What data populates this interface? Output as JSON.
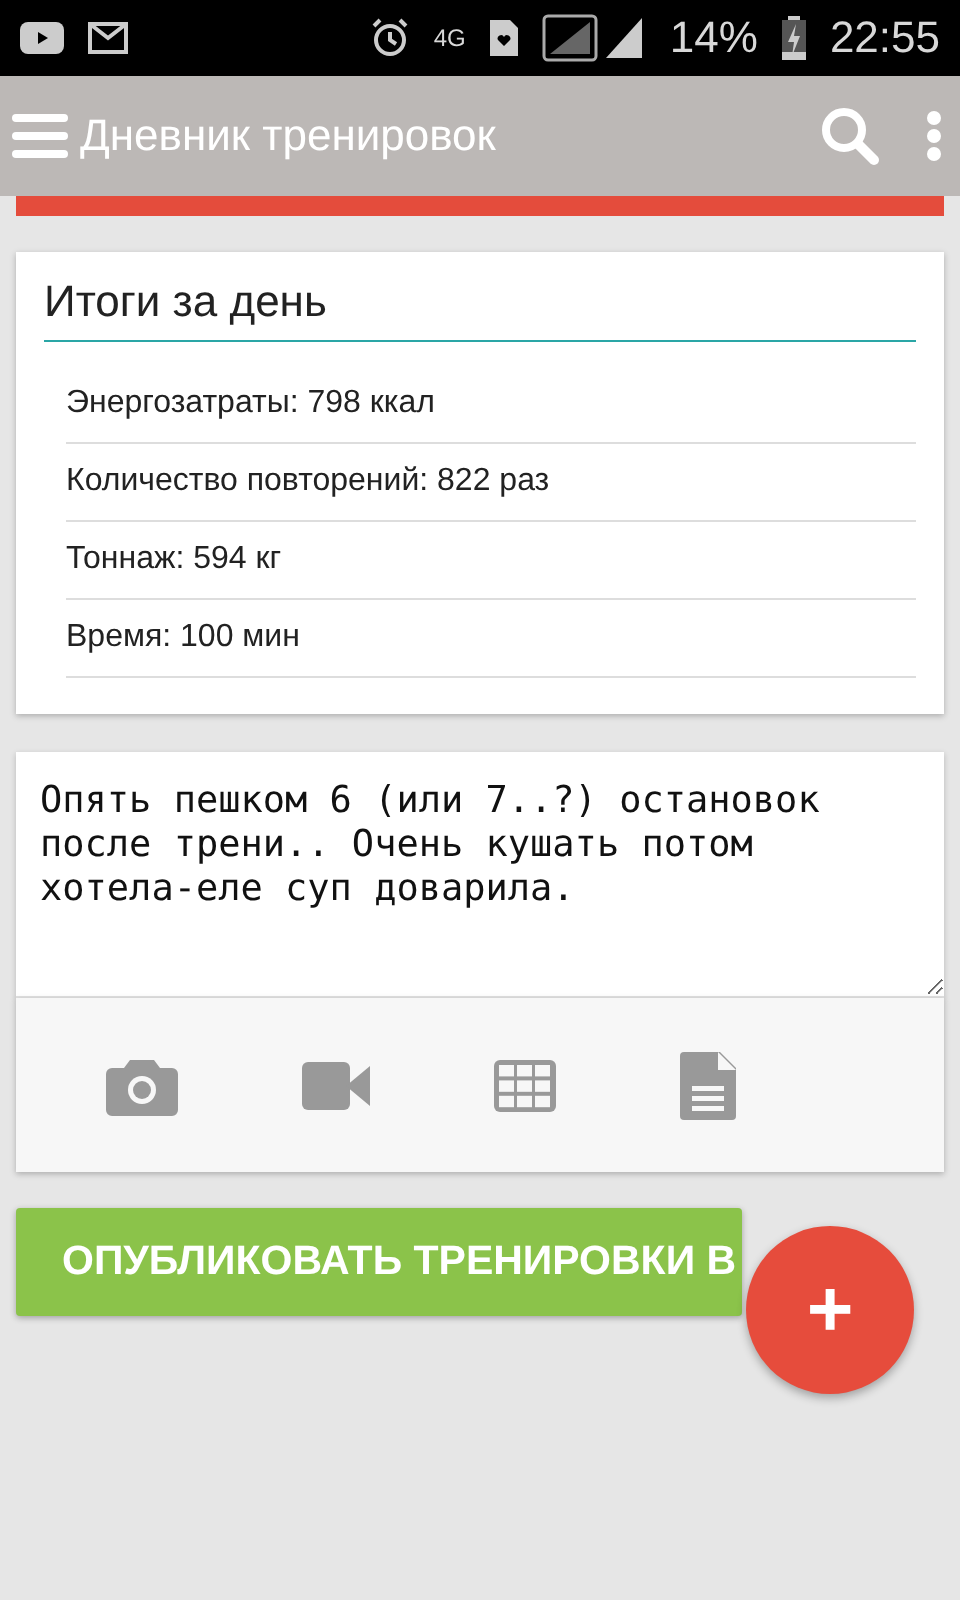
{
  "status_bar": {
    "network": "4G",
    "battery": "14%",
    "time": "22:55"
  },
  "app_bar": {
    "title": "Дневник тренировок"
  },
  "summary": {
    "title": "Итоги за день",
    "rows": [
      "Энергозатраты: 798 ккал",
      "Количество повторений: 822 раз",
      "Тоннаж: 594 кг",
      "Время: 100 мин"
    ]
  },
  "note": {
    "value": "Опять пешком 6 (или 7..?) остановок после трени.. Очень кушать потом хотела-еле суп доварила.",
    "attachments": [
      {
        "kind": "camera"
      },
      {
        "kind": "video"
      },
      {
        "kind": "table"
      },
      {
        "kind": "document"
      }
    ]
  },
  "publish_button": {
    "label": "ОПУБЛИКОВАТЬ ТРЕНИРОВКИ В"
  },
  "fab": {
    "label": "+"
  }
}
